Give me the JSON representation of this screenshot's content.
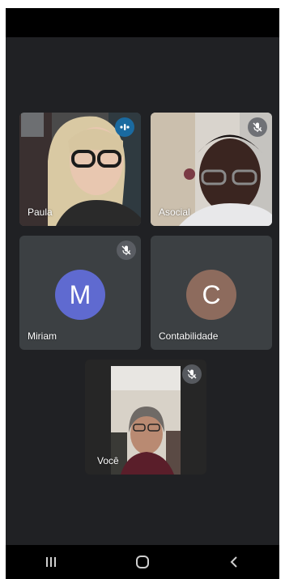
{
  "participants": {
    "paula": {
      "name": "Paula",
      "status": "speaking"
    },
    "asocial": {
      "name": "Asocial",
      "status": "muted"
    },
    "miriam": {
      "name": "Miriam",
      "initial": "M",
      "avatar_color": "#5f6ad0",
      "status": "muted"
    },
    "contabilidade": {
      "name": "Contabilidade",
      "initial": "C",
      "avatar_color": "#8d6b5d"
    },
    "self": {
      "name": "Você",
      "status": "muted"
    }
  },
  "icons": {
    "mic_off": "mic-off-icon",
    "speaking": "audio-level-icon",
    "recents": "recents-icon",
    "home": "home-icon",
    "back": "back-icon"
  }
}
